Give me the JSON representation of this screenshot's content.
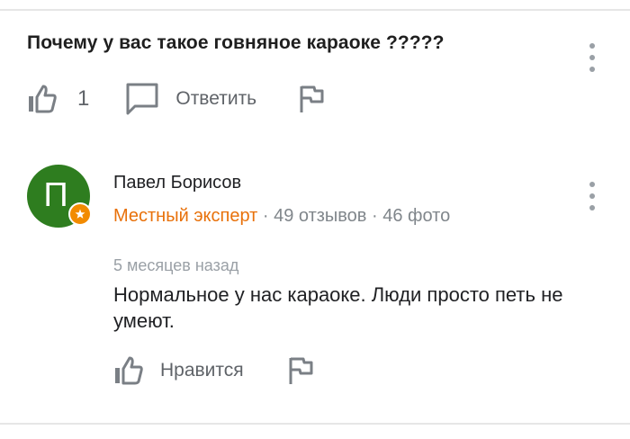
{
  "question": {
    "text": "Почему у вас такое говняное караоке ?????",
    "like_count": "1",
    "reply_label": "Ответить"
  },
  "answer": {
    "avatar_letter": "П",
    "author": "Павел Борисов",
    "badge": "Местный эксперт",
    "separator": " · ",
    "reviews": "49 отзывов",
    "photos": "46 фото",
    "time": "5 месяцев назад",
    "text": "Нормальное у нас караоке. Люди просто петь не умеют.",
    "like_label": "Нравится"
  },
  "colors": {
    "avatar": "#2e7d1f",
    "badge": "#f28b00",
    "expert_text": "#e8710a",
    "muted": "#80868b"
  },
  "icons": [
    "thumbs-up-icon",
    "reply-box-icon",
    "flag-icon",
    "more-vert-icon",
    "star-badge-icon"
  ]
}
